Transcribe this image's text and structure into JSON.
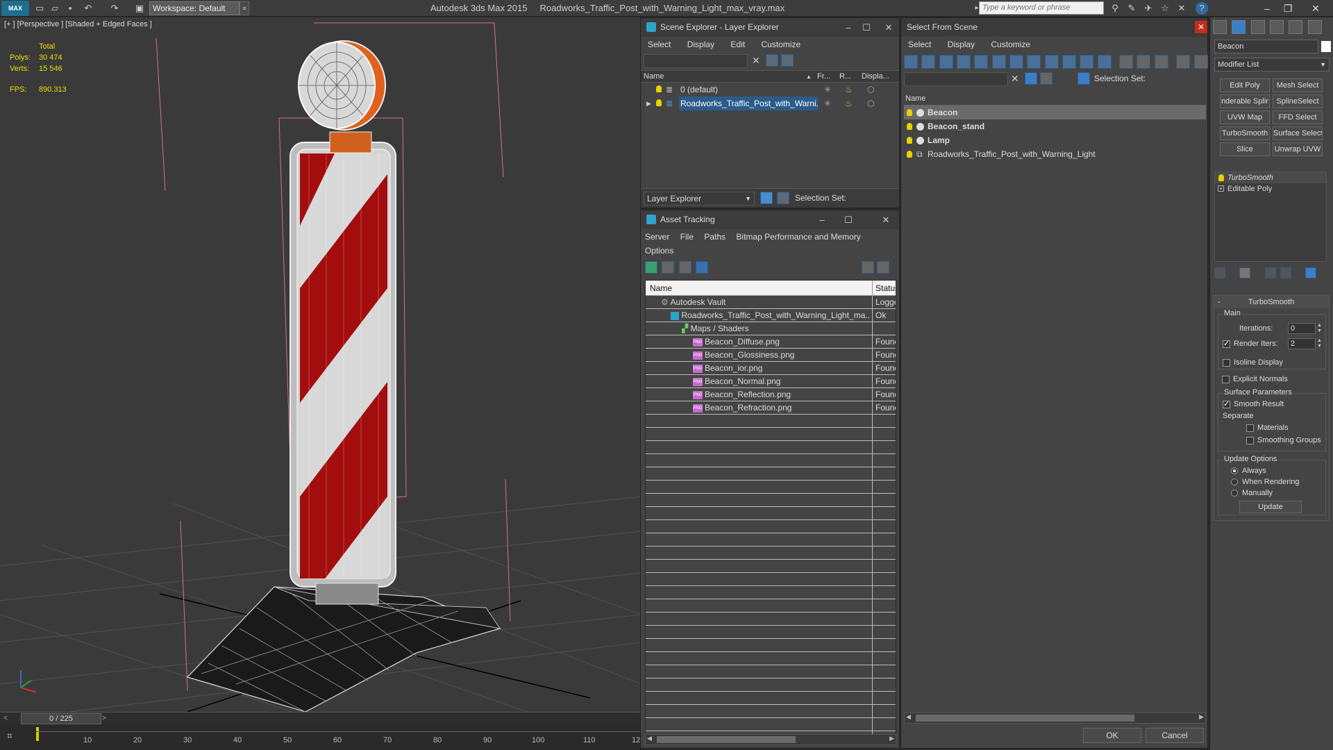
{
  "titlebar": {
    "logo": "MAX",
    "workspace": "Workspace: Default",
    "app_name": "Autodesk 3ds Max  2015",
    "file_name": "Roadworks_Traffic_Post_with_Warning_Light_max_vray.max",
    "search_placeholder": "Type a keyword or phrase"
  },
  "viewport": {
    "label": "[+ ] [Perspective ] [Shaded + Edged Faces ]",
    "stats": {
      "total_label": "Total",
      "polys_label": "Polys:",
      "polys_value": "30 474",
      "verts_label": "Verts:",
      "verts_value": "15 546",
      "fps_label": "FPS:",
      "fps_value": "890.313"
    }
  },
  "timeline": {
    "frame_readout": "0 / 225",
    "ticks": [
      "10",
      "20",
      "30",
      "40",
      "50",
      "60",
      "70",
      "80",
      "90",
      "100",
      "110",
      "12"
    ]
  },
  "scene_explorer": {
    "title": "Scene Explorer - Layer Explorer",
    "menu": [
      "Select",
      "Display",
      "Edit",
      "Customize"
    ],
    "columns": {
      "name": "Name",
      "freeze": "Fr...",
      "render": "R...",
      "display": "Displa..."
    },
    "rows": [
      {
        "name": "0 (default)",
        "selected": false
      },
      {
        "name": "Roadworks_Traffic_Post_with_Warni...",
        "selected": true
      }
    ],
    "footer_dropdown": "Layer Explorer",
    "selection_set_label": "Selection Set:"
  },
  "asset_tracking": {
    "title": "Asset Tracking",
    "menu": [
      "Server",
      "File",
      "Paths",
      "Bitmap Performance and Memory"
    ],
    "menu2": [
      "Options"
    ],
    "columns": {
      "name": "Name",
      "status": "Status"
    },
    "rows": [
      {
        "name": "Autodesk Vault",
        "status": "Logge",
        "indent": 0,
        "icon": "vault"
      },
      {
        "name": "Roadworks_Traffic_Post_with_Warning_Light_ma...",
        "status": "Ok",
        "indent": 1,
        "icon": "max"
      },
      {
        "name": "Maps / Shaders",
        "status": "",
        "indent": 2,
        "icon": "maps"
      },
      {
        "name": "Beacon_Diffuse.png",
        "status": "Found",
        "indent": 3,
        "icon": "png"
      },
      {
        "name": "Beacon_Glossiness.png",
        "status": "Found",
        "indent": 3,
        "icon": "png"
      },
      {
        "name": "Beacon_ior.png",
        "status": "Found",
        "indent": 3,
        "icon": "png"
      },
      {
        "name": "Beacon_Normal.png",
        "status": "Found",
        "indent": 3,
        "icon": "png"
      },
      {
        "name": "Beacon_Reflection.png",
        "status": "Found",
        "indent": 3,
        "icon": "png"
      },
      {
        "name": "Beacon_Refraction.png",
        "status": "Found",
        "indent": 3,
        "icon": "png"
      }
    ],
    "png_icon_text": "PNG"
  },
  "select_from_scene": {
    "title": "Select From Scene",
    "menu": [
      "Select",
      "Display",
      "Customize"
    ],
    "selection_set_label": "Selection Set:",
    "column_name": "Name",
    "rows": [
      {
        "name": "Beacon",
        "bold": true,
        "selected": true
      },
      {
        "name": "Beacon_stand",
        "bold": true,
        "selected": false
      },
      {
        "name": "Lamp",
        "bold": true,
        "selected": false
      },
      {
        "name": "Roadworks_Traffic_Post_with_Warning_Light",
        "bold": false,
        "selected": false
      }
    ],
    "ok_label": "OK",
    "cancel_label": "Cancel"
  },
  "command_panel": {
    "object_name": "Beacon",
    "modifier_list": "Modifier List",
    "modifier_buttons": [
      "Edit Poly",
      "Mesh Select",
      "nderable Splir",
      "SplineSelect",
      "UVW Map",
      "FFD Select",
      "TurboSmooth",
      "Surface Select",
      "Slice",
      "Unwrap UVW"
    ],
    "stack": [
      "TurboSmooth",
      "Editable Poly"
    ],
    "turbosmooth": {
      "title": "TurboSmooth",
      "main_label": "Main",
      "iterations_label": "Iterations:",
      "iterations_value": "0",
      "render_iters_label": "Render Iters:",
      "render_iters_value": "2",
      "render_iters_checked": true,
      "isoline_label": "Isoline Display",
      "explicit_normals_label": "Explicit Normals",
      "surface_label": "Surface Parameters",
      "smooth_result_label": "Smooth Result",
      "smooth_result_checked": true,
      "separate_label": "Separate",
      "materials_label": "Materials",
      "smoothing_groups_label": "Smoothing Groups",
      "update_options_label": "Update Options",
      "always_label": "Always",
      "when_rendering_label": "When Rendering",
      "manually_label": "Manually",
      "update_button": "Update",
      "rollout_toggle": "-"
    }
  },
  "colors": {
    "selection_blue": "#2b5b8a",
    "stripe_red": "#a40d0d",
    "beacon_orange": "#e0601e",
    "stats_yellow": "#e8e000"
  }
}
